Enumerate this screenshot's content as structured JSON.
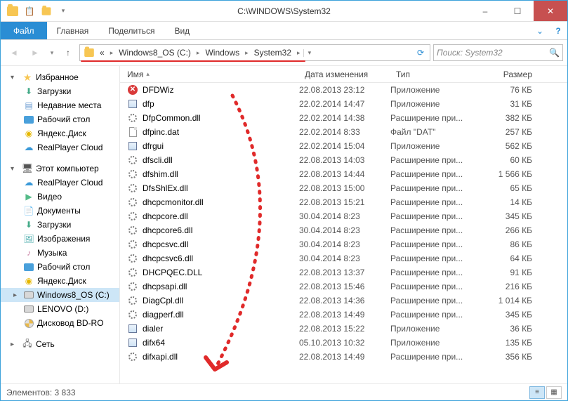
{
  "window": {
    "title": "C:\\WINDOWS\\System32",
    "minimize": "–",
    "maximize": "☐",
    "close": "✕"
  },
  "ribbon": {
    "file": "Файл",
    "tabs": [
      "Главная",
      "Поделиться",
      "Вид"
    ]
  },
  "breadcrumb": {
    "prefix": "«",
    "segments": [
      "Windows8_OS (C:)",
      "Windows",
      "System32"
    ]
  },
  "search": {
    "placeholder": "Поиск: System32"
  },
  "columns": {
    "name": "Имя",
    "date": "Дата изменения",
    "type": "Тип",
    "size": "Размер"
  },
  "sidebar": {
    "favorites": {
      "label": "Избранное",
      "items": [
        "Загрузки",
        "Недавние места",
        "Рабочий стол",
        "Яндекс.Диск",
        "RealPlayer Cloud"
      ]
    },
    "thispc": {
      "label": "Этот компьютер",
      "items": [
        "RealPlayer Cloud",
        "Видео",
        "Документы",
        "Загрузки",
        "Изображения",
        "Музыка",
        "Рабочий стол",
        "Яндекс.Диск",
        "Windows8_OS (C:)",
        "LENOVO (D:)",
        "Дисковод BD-RO"
      ]
    },
    "network": {
      "label": "Сеть"
    }
  },
  "files": [
    {
      "icon": "redx",
      "name": "DFDWiz",
      "date": "22.08.2013 23:12",
      "type": "Приложение",
      "size": "76 КБ"
    },
    {
      "icon": "app",
      "name": "dfp",
      "date": "22.02.2014 14:47",
      "type": "Приложение",
      "size": "31 КБ"
    },
    {
      "icon": "gear",
      "name": "DfpCommon.dll",
      "date": "22.02.2014 14:38",
      "type": "Расширение при...",
      "size": "382 КБ"
    },
    {
      "icon": "page",
      "name": "dfpinc.dat",
      "date": "22.02.2014 8:33",
      "type": "Файл \"DAT\"",
      "size": "257 КБ"
    },
    {
      "icon": "app",
      "name": "dfrgui",
      "date": "22.02.2014 15:04",
      "type": "Приложение",
      "size": "562 КБ"
    },
    {
      "icon": "gear",
      "name": "dfscli.dll",
      "date": "22.08.2013 14:03",
      "type": "Расширение при...",
      "size": "60 КБ"
    },
    {
      "icon": "gear",
      "name": "dfshim.dll",
      "date": "22.08.2013 14:44",
      "type": "Расширение при...",
      "size": "1 566 КБ"
    },
    {
      "icon": "gear",
      "name": "DfsShlEx.dll",
      "date": "22.08.2013 15:00",
      "type": "Расширение при...",
      "size": "65 КБ"
    },
    {
      "icon": "gear",
      "name": "dhcpcmonitor.dll",
      "date": "22.08.2013 15:21",
      "type": "Расширение при...",
      "size": "14 КБ"
    },
    {
      "icon": "gear",
      "name": "dhcpcore.dll",
      "date": "30.04.2014 8:23",
      "type": "Расширение при...",
      "size": "345 КБ"
    },
    {
      "icon": "gear",
      "name": "dhcpcore6.dll",
      "date": "30.04.2014 8:23",
      "type": "Расширение при...",
      "size": "266 КБ"
    },
    {
      "icon": "gear",
      "name": "dhcpcsvc.dll",
      "date": "30.04.2014 8:23",
      "type": "Расширение при...",
      "size": "86 КБ"
    },
    {
      "icon": "gear",
      "name": "dhcpcsvc6.dll",
      "date": "30.04.2014 8:23",
      "type": "Расширение при...",
      "size": "64 КБ"
    },
    {
      "icon": "gear",
      "name": "DHCPQEC.DLL",
      "date": "22.08.2013 13:37",
      "type": "Расширение при...",
      "size": "91 КБ"
    },
    {
      "icon": "gear",
      "name": "dhcpsapi.dll",
      "date": "22.08.2013 15:46",
      "type": "Расширение при...",
      "size": "216 КБ"
    },
    {
      "icon": "gear",
      "name": "DiagCpl.dll",
      "date": "22.08.2013 14:36",
      "type": "Расширение при...",
      "size": "1 014 КБ"
    },
    {
      "icon": "gear",
      "name": "diagperf.dll",
      "date": "22.08.2013 14:49",
      "type": "Расширение при...",
      "size": "345 КБ"
    },
    {
      "icon": "app",
      "name": "dialer",
      "date": "22.08.2013 15:22",
      "type": "Приложение",
      "size": "36 КБ"
    },
    {
      "icon": "app",
      "name": "difx64",
      "date": "05.10.2013 10:32",
      "type": "Приложение",
      "size": "135 КБ"
    },
    {
      "icon": "gear",
      "name": "difxapi.dll",
      "date": "22.08.2013 14:49",
      "type": "Расширение при...",
      "size": "356 КБ"
    }
  ],
  "status": {
    "count_label": "Элементов: 3 833"
  }
}
